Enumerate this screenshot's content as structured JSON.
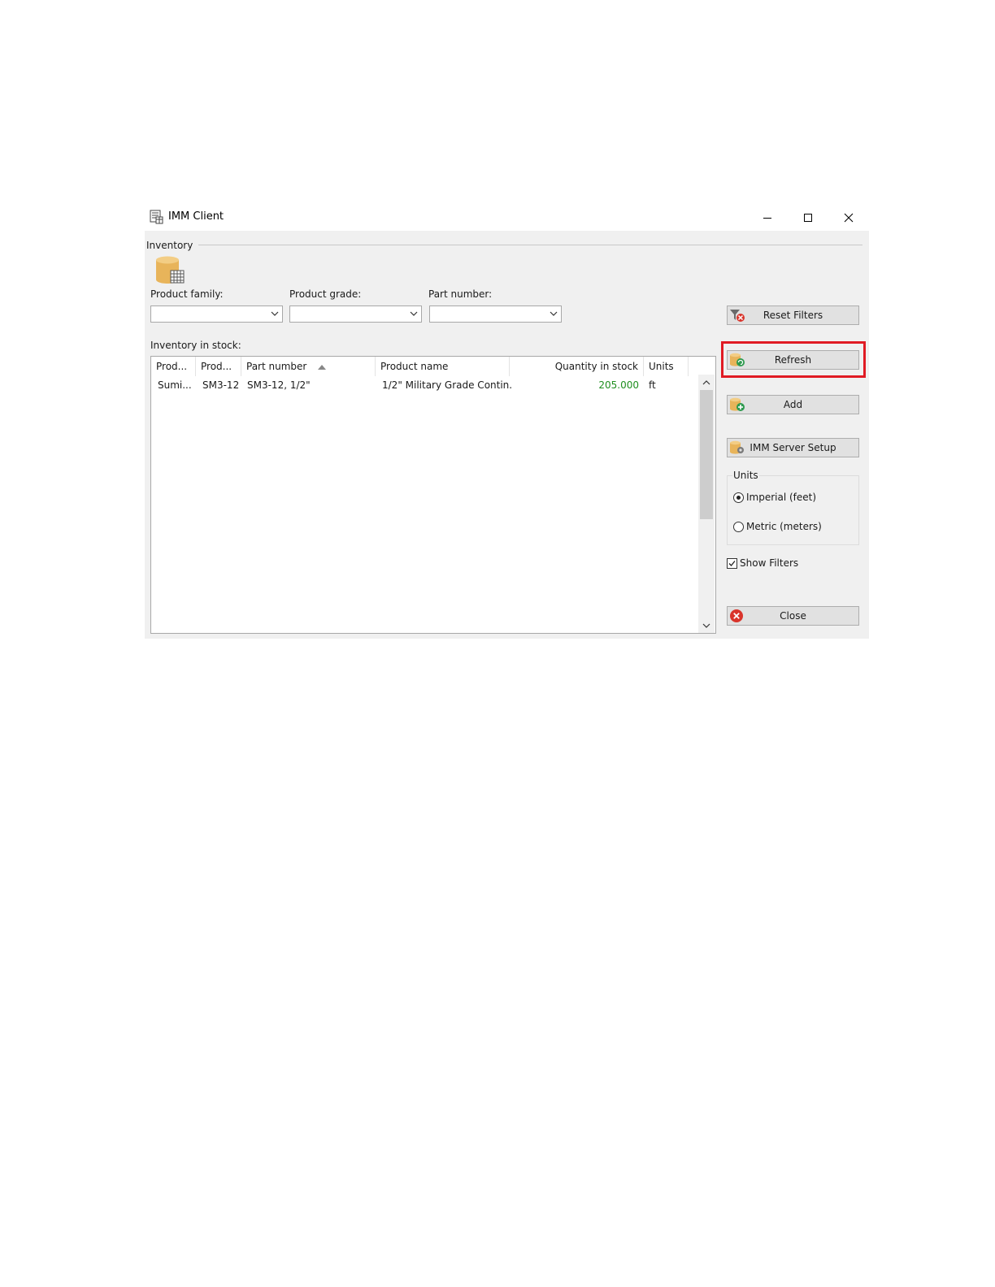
{
  "window": {
    "title": "IMM Client",
    "minimize_icon": "minimize-icon",
    "maximize_icon": "maximize-icon",
    "close_icon": "close-icon"
  },
  "inventory": {
    "group_label": "Inventory",
    "icon": "database-table-icon"
  },
  "filters": {
    "product_family": {
      "label": "Product family:",
      "value": ""
    },
    "product_grade": {
      "label": "Product grade:",
      "value": ""
    },
    "part_number": {
      "label": "Part number:",
      "value": ""
    }
  },
  "stock": {
    "label": "Inventory in stock:",
    "columns": [
      "Prod...",
      "Prod...",
      "Part number",
      "Product name",
      "Quantity in stock",
      "Units"
    ],
    "sort_column": "Part number",
    "sort_direction": "ascending",
    "rows": [
      [
        "Sumi...",
        "SM3-12",
        "SM3-12, 1/2\"",
        "1/2\" Military Grade Contin...",
        "205.000",
        "ft"
      ]
    ],
    "quantity_color": "#1f8f1f"
  },
  "buttons": {
    "reset_filters": "Reset Filters",
    "refresh": "Refresh",
    "add": "Add",
    "server_setup": "IMM Server Setup",
    "close": "Close"
  },
  "units": {
    "title": "Units",
    "options": [
      {
        "label": "Imperial (feet)",
        "selected": true
      },
      {
        "label": "Metric (meters)",
        "selected": false
      }
    ]
  },
  "show_filters": {
    "label": "Show Filters",
    "checked": true
  },
  "colors": {
    "highlight": "#e01b24",
    "window_bg": "#f0f0f0",
    "database_icon": "#e8b45a"
  }
}
